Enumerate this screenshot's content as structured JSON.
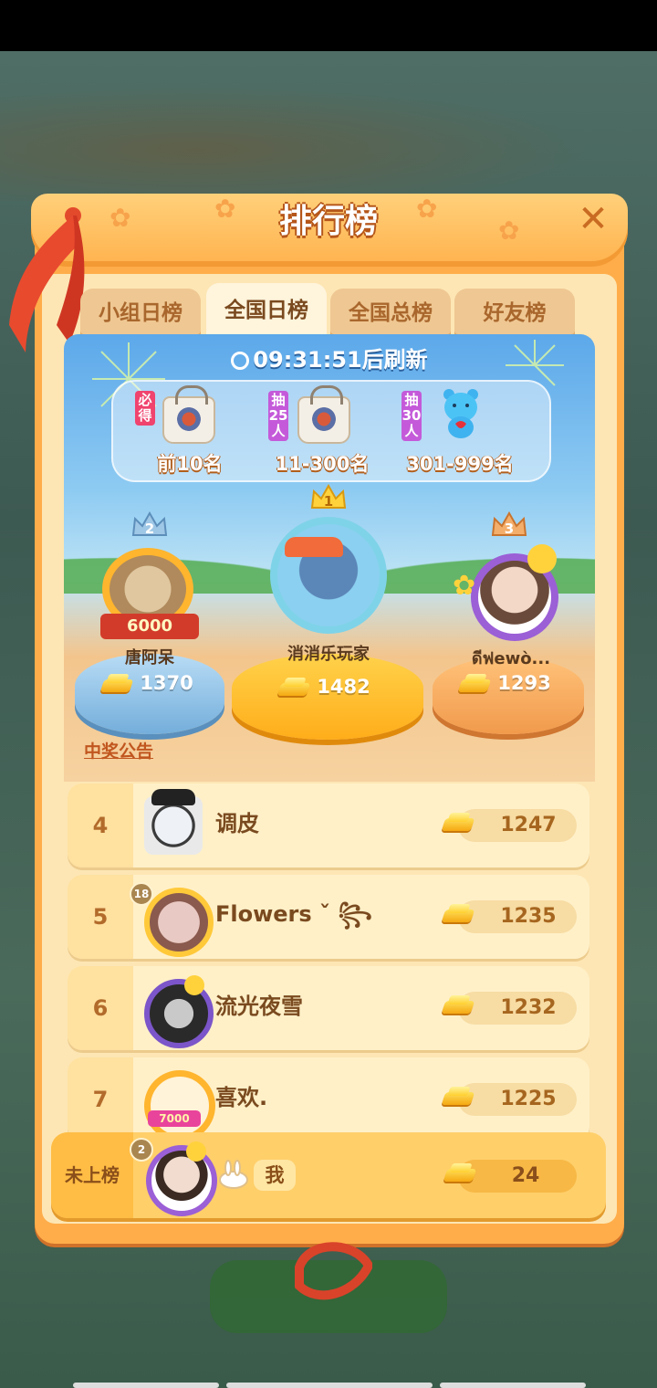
{
  "panel": {
    "title": "排行榜",
    "close_icon": "close-icon"
  },
  "tabs": [
    {
      "label": "小组日榜",
      "active": false
    },
    {
      "label": "全国日榜",
      "active": true
    },
    {
      "label": "全国总榜",
      "active": false
    },
    {
      "label": "好友榜",
      "active": false
    }
  ],
  "refresh": {
    "time": "09:31:51",
    "suffix": "后刷新"
  },
  "rewards": [
    {
      "tag": "必得",
      "label": "前10名",
      "icon": "gift-bag-icon"
    },
    {
      "tag": "抽25人",
      "label": "11-300名",
      "icon": "gift-bag-icon"
    },
    {
      "tag": "抽30人",
      "label": "301-999名",
      "icon": "blue-bear-icon"
    }
  ],
  "podium": [
    {
      "rank": "2",
      "name": "唐阿呆",
      "score": "1370",
      "frame_text": "6000",
      "color": "#8fc3ea"
    },
    {
      "rank": "1",
      "name": "消消乐玩家",
      "score": "1482",
      "color": "#ffbf2e"
    },
    {
      "rank": "3",
      "name": "ดีฟewò...",
      "score": "1293",
      "color": "#f3a456"
    }
  ],
  "notice_link": "中奖公告",
  "list": [
    {
      "rank": "4",
      "name": "调皮",
      "score": "1247"
    },
    {
      "rank": "5",
      "name": "Flowers ˇ ꧂",
      "score": "1235",
      "level": "18"
    },
    {
      "rank": "6",
      "name": "流光夜雪",
      "score": "1232"
    },
    {
      "rank": "7",
      "name": "喜欢.",
      "score": "1225",
      "frame_text": "7000"
    }
  ],
  "me": {
    "rank_label": "未上榜",
    "name": "我",
    "score": "24",
    "level": "2"
  },
  "colors": {
    "panel": "#ffad4a",
    "inner": "#fde6b4",
    "accent": "#c1561f"
  }
}
